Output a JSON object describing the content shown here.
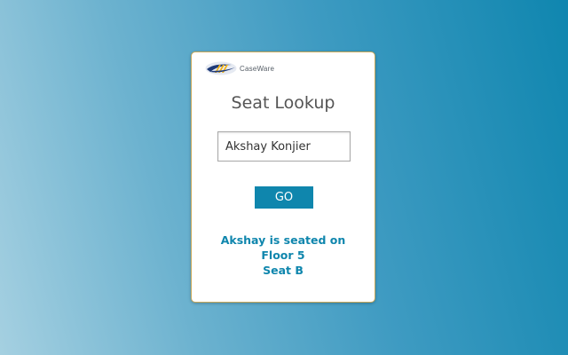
{
  "logo": {
    "brand_text": "CaseWare",
    "icon": "caseware-logo-mark"
  },
  "title": "Seat Lookup",
  "search": {
    "value": "Akshay Konjier"
  },
  "go_button": {
    "label": "GO"
  },
  "result": {
    "line1": "Akshay is seated on",
    "line2": "Floor 5",
    "line3": "Seat B"
  },
  "colors": {
    "accent": "#0f86ad",
    "card_border": "#c7a85a",
    "background_start": "#a5d0e1",
    "background_end": "#0f86af"
  }
}
